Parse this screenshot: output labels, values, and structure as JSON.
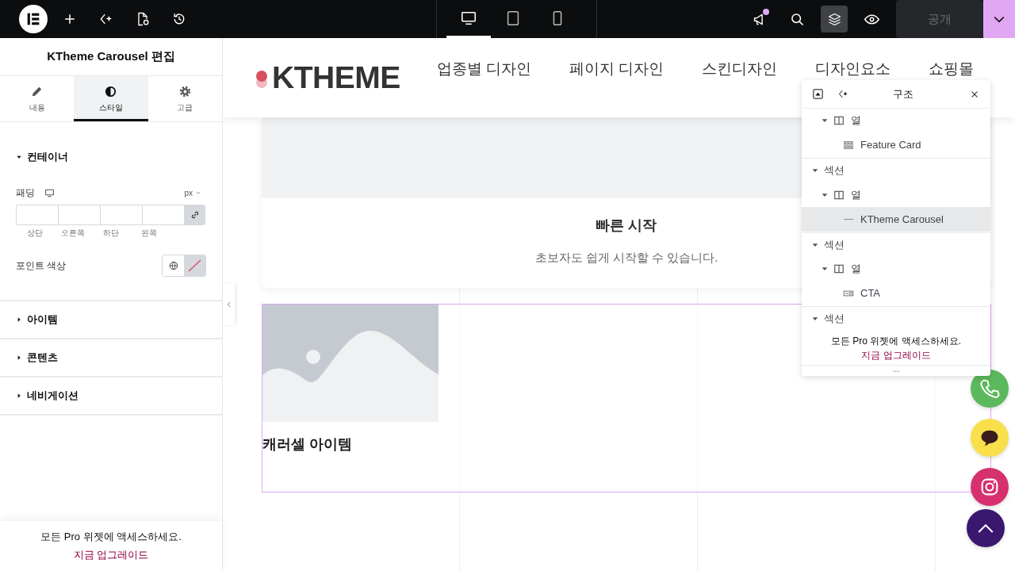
{
  "topbar": {
    "left_tools": [
      {
        "kind": "add"
      },
      {
        "kind": "ai"
      },
      {
        "kind": "page-settings"
      },
      {
        "kind": "history"
      }
    ],
    "devices": [
      {
        "kind": "desktop",
        "selected": true
      },
      {
        "kind": "tablet",
        "selected": false
      },
      {
        "kind": "mobile",
        "selected": false
      }
    ],
    "right_tools": [
      {
        "kind": "announcements",
        "active": false,
        "notification": true
      },
      {
        "kind": "search",
        "active": false,
        "notification": false
      },
      {
        "kind": "structure",
        "active": true,
        "notification": false
      },
      {
        "kind": "preview",
        "active": false,
        "notification": false
      }
    ],
    "publish": {
      "label": "공개",
      "disabled": true
    }
  },
  "editor": {
    "title": "KTheme Carousel 편집",
    "tabs": [
      {
        "kind": "content",
        "label": "내용",
        "selected": false
      },
      {
        "kind": "style",
        "label": "스타일",
        "selected": true
      },
      {
        "kind": "advanced",
        "label": "고급",
        "selected": false
      }
    ],
    "sections": [
      {
        "title": "컨테이너",
        "expanded": true,
        "controls": [
          {
            "kind": "dimensions",
            "label": "패딩",
            "unit": "px",
            "sides": [
              "상단",
              "오른쪽",
              "하단",
              "왼쪽"
            ],
            "linked": true
          },
          {
            "kind": "color",
            "label": "포인트 색상"
          }
        ]
      },
      {
        "title": "아이템",
        "expanded": false
      },
      {
        "title": "콘텐츠",
        "expanded": false
      },
      {
        "title": "네비게이션",
        "expanded": false
      }
    ],
    "promo": {
      "text": "모든 Pro 위젯에 액세스하세요.",
      "link": "지금 업그레이드"
    }
  },
  "canvas": {
    "logo": "KTHEME",
    "nav": [
      "업종별 디자인",
      "페이지 디자인",
      "스킨디자인",
      "디자인요소",
      "쇼핑몰"
    ],
    "feature_card": {
      "title": "빠른 시작",
      "text": "초보자도 쉽게 시작할 수 있습니다."
    },
    "carousel": {
      "items": [
        {
          "title": "캐러셀 아이템"
        }
      ]
    }
  },
  "structure": {
    "title": "구조",
    "continued": [
      {
        "kind": "column",
        "label": "열",
        "expanded": true,
        "selected": false,
        "children": [
          {
            "kind": "grid-widget",
            "label": "Feature Card",
            "selected": false
          }
        ]
      }
    ],
    "tree": [
      {
        "kind": "section",
        "label": "섹션",
        "expanded": true,
        "selected": false,
        "children": [
          {
            "kind": "column",
            "label": "열",
            "expanded": true,
            "selected": false,
            "children": [
              {
                "kind": "carousel-widget",
                "label": "KTheme Carousel",
                "selected": true
              }
            ]
          }
        ]
      },
      {
        "kind": "section",
        "label": "섹션",
        "expanded": true,
        "selected": false,
        "children": [
          {
            "kind": "column",
            "label": "열",
            "expanded": true,
            "selected": false,
            "children": [
              {
                "kind": "cta-widget",
                "label": "CTA",
                "selected": false
              }
            ]
          }
        ]
      },
      {
        "kind": "section",
        "label": "섹션",
        "expanded": true,
        "selected": false
      }
    ],
    "promo": {
      "text": "모든 Pro 위젯에 액세스하세요.",
      "link": "지금 업그레이드"
    },
    "more": "..."
  },
  "floating_buttons": [
    {
      "kind": "phone",
      "color": "#5cb85c"
    },
    {
      "kind": "chat",
      "color": "#f9e04b"
    },
    {
      "kind": "instagram",
      "color": "#d6306f"
    },
    {
      "kind": "top",
      "color": "#3a1870"
    }
  ]
}
